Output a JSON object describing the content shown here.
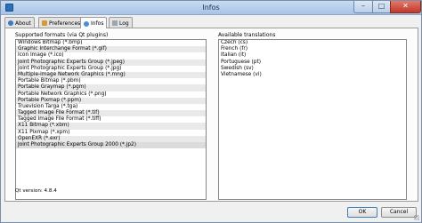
{
  "window": {
    "title": "Infos"
  },
  "tabs": [
    {
      "label": "About",
      "icon": "info-icon"
    },
    {
      "label": "Preferences",
      "icon": "preferences-icon"
    },
    {
      "label": "Infos",
      "icon": "infos-icon",
      "active": true
    },
    {
      "label": "Log",
      "icon": "log-icon"
    }
  ],
  "formats": {
    "group_label": "Supported formats (via Qt plugins)",
    "items": [
      "Windows Bitmap (*.bmp)",
      "Graphic Interchange Format (*.gif)",
      "Icon Image (*.ico)",
      "Joint Photographic Experts Group (*.jpeg)",
      "Joint Photographic Experts Group (*.jpg)",
      "Multiple-image Network Graphics (*.mng)",
      "Portable Bitmap (*.pbm)",
      "Portable Graymap (*.pgm)",
      "Portable Network Graphics (*.png)",
      "Portable Pixmap (*.ppm)",
      "Truevision Targa (*.tga)",
      "Tagged Image File Format (*.tif)",
      "Tagged Image File Format (*.tiff)",
      "X11 Bitmap (*.xbm)",
      "X11 Pixmap (*.xpm)",
      "OpenEXR (*.exr)",
      "Joint Photographic Experts Group 2000 (*.jp2)"
    ],
    "qt_version": "Qt version: 4.8.4"
  },
  "translations": {
    "group_label": "Available translations",
    "items": [
      "Czech (cs)",
      "French (fr)",
      "Italian (it)",
      "Portuguese (pt)",
      "Swedish (sv)",
      "Vietnamese (vi)"
    ]
  },
  "buttons": {
    "ok": "OK",
    "cancel": "Cancel"
  },
  "colors": {
    "accent": "#3c7fb1",
    "info_icon": "#3a79c5",
    "preferences_icon": "#d89a2c",
    "infos_icon": "#4a8fd6",
    "log_icon": "#9aa6b2"
  }
}
